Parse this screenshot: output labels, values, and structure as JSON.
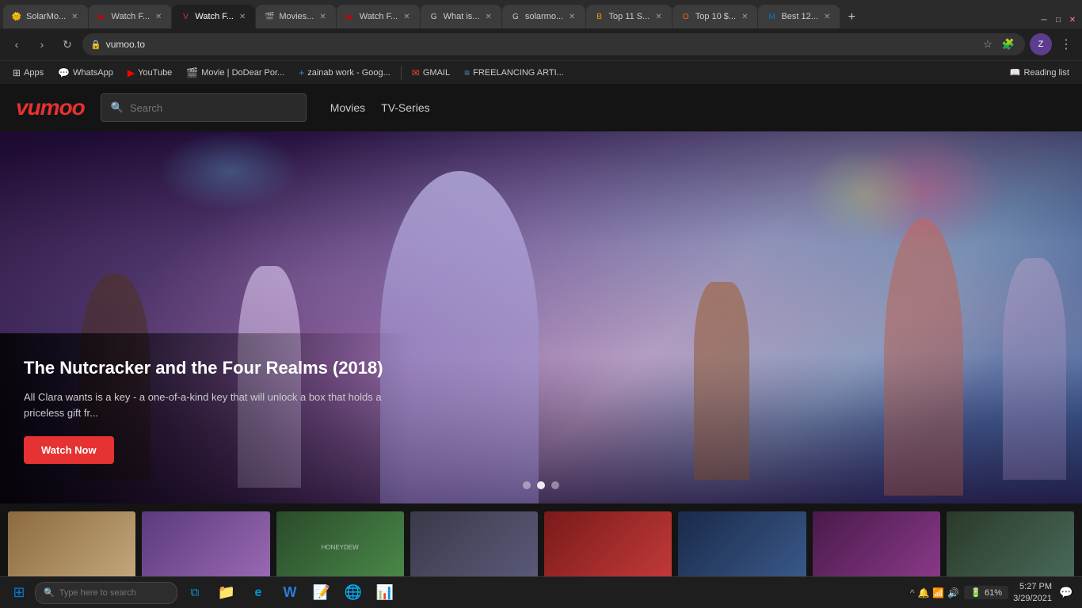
{
  "browser": {
    "tabs": [
      {
        "id": 1,
        "label": "SolarMo...",
        "favicon": "🌞",
        "active": false,
        "closable": true
      },
      {
        "id": 2,
        "label": "Watch F...",
        "favicon": "▶",
        "active": false,
        "closable": true
      },
      {
        "id": 3,
        "label": "Watch F...",
        "favicon": "▶",
        "active": true,
        "closable": true
      },
      {
        "id": 4,
        "label": "Movies...",
        "favicon": "🎬",
        "active": false,
        "closable": true
      },
      {
        "id": 5,
        "label": "Watch F...",
        "favicon": "▶",
        "active": false,
        "closable": true
      },
      {
        "id": 6,
        "label": "What is...",
        "favicon": "?",
        "active": false,
        "closable": true
      },
      {
        "id": 7,
        "label": "solarmo...",
        "favicon": "🌞",
        "active": false,
        "closable": true
      },
      {
        "id": 8,
        "label": "Top 11 S...",
        "favicon": "⭐",
        "active": false,
        "closable": true
      },
      {
        "id": 9,
        "label": "Top 10 $...",
        "favicon": "💰",
        "active": false,
        "closable": true
      },
      {
        "id": 10,
        "label": "Best 12...",
        "favicon": "🏆",
        "active": false,
        "closable": true
      }
    ],
    "url": "vumoo.to",
    "profile_initial": "Z"
  },
  "bookmarks": [
    {
      "label": "Apps",
      "icon": "⊞"
    },
    {
      "label": "WhatsApp",
      "icon": "💬"
    },
    {
      "label": "YouTube",
      "icon": "▶"
    },
    {
      "label": "Movie | DoDear Por...",
      "icon": "🎬"
    },
    {
      "label": "zainab work - Goog...",
      "icon": "+"
    },
    {
      "label": "GMAIL",
      "icon": "✉"
    },
    {
      "label": "FREELANCING ARTI...",
      "icon": "📋"
    }
  ],
  "reading_list": {
    "label": "Reading list",
    "icon": "📖"
  },
  "site": {
    "logo": "vumoo",
    "search_placeholder": "Search",
    "nav": [
      {
        "label": "Movies"
      },
      {
        "label": "TV-Series"
      }
    ],
    "hero": {
      "title": "The Nutcracker and the Four Realms (2018)",
      "description": "All Clara wants is a key - a one-of-a-kind key that will unlock a box that holds a priceless gift fr...",
      "watch_button": "Watch Now",
      "dots": [
        false,
        true,
        false
      ]
    },
    "thumbnails": [
      {
        "color_class": "thumb-1"
      },
      {
        "color_class": "thumb-2"
      },
      {
        "color_class": "thumb-3"
      },
      {
        "color_class": "thumb-4"
      },
      {
        "color_class": "thumb-5"
      },
      {
        "color_class": "thumb-6"
      },
      {
        "color_class": "thumb-7"
      },
      {
        "color_class": "thumb-8"
      }
    ]
  },
  "taskbar": {
    "search_placeholder": "Type here to search",
    "apps": [
      {
        "icon": "⊞",
        "label": "start",
        "color": "#0078d4"
      },
      {
        "icon": "🔍",
        "label": "search"
      },
      {
        "icon": "🌀",
        "label": "task-view"
      },
      {
        "icon": "📁",
        "label": "file-explorer"
      },
      {
        "icon": "🌐",
        "label": "edge"
      },
      {
        "icon": "V",
        "label": "office-w"
      },
      {
        "icon": "📝",
        "label": "word"
      },
      {
        "icon": "🌐",
        "label": "chrome"
      },
      {
        "icon": "📊",
        "label": "data"
      }
    ],
    "battery": "61%",
    "time": "5:27 PM",
    "date": "3/29/2021"
  }
}
